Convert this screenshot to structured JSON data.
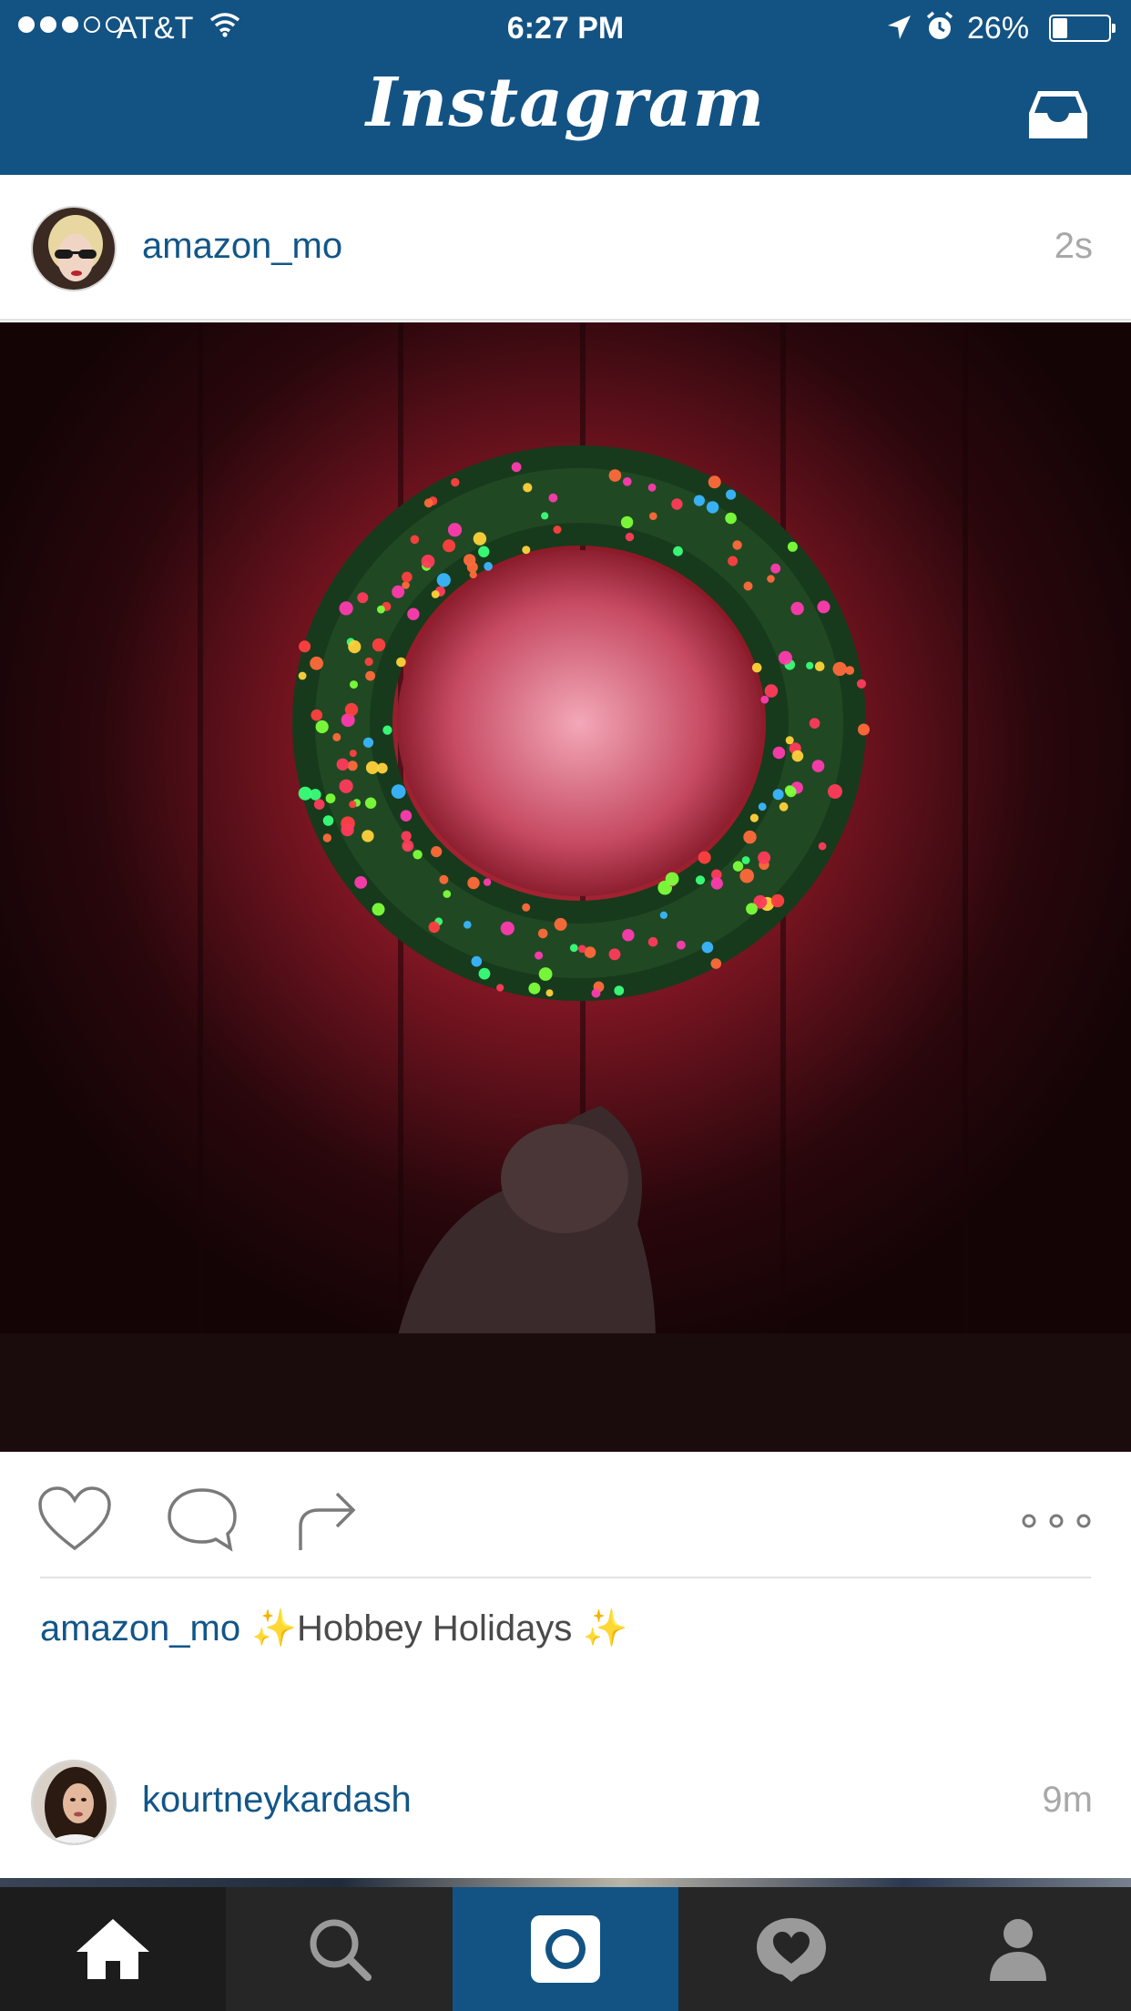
{
  "status_bar": {
    "carrier": "AT&T",
    "time": "6:27 PM",
    "battery_percent": "26%",
    "battery_level": 0.26,
    "signal_bars_filled": 3,
    "signal_bars_total": 5,
    "icons": [
      "signal-dots-icon",
      "wifi-icon",
      "location-arrow-icon",
      "alarm-icon",
      "battery-icon"
    ]
  },
  "nav": {
    "title": "Instagram",
    "right_icon": "inbox-icon",
    "background_color": "#135384"
  },
  "post": {
    "username": "amazon_mo",
    "time_ago": "2s",
    "photo_description_icon": "photo",
    "actions": [
      "heart-icon",
      "comment-icon",
      "share-icon",
      "more-options-icon"
    ],
    "caption": {
      "username": "amazon_mo",
      "sparkle_before": "✨",
      "text": "Hobbey Holidays",
      "sparkle_after": "✨"
    }
  },
  "next_post": {
    "username": "kourtneykardash",
    "time_ago": "9m"
  },
  "tab_bar": {
    "tabs": [
      {
        "icon": "home-icon",
        "active": true
      },
      {
        "icon": "search-icon",
        "active": false
      },
      {
        "icon": "camera-icon",
        "active": false
      },
      {
        "icon": "activity-heart-icon",
        "active": false
      },
      {
        "icon": "profile-icon",
        "active": false
      }
    ]
  },
  "colors": {
    "brand_blue": "#135384",
    "username_blue": "#125688",
    "muted_gray": "#a8a8a8",
    "tab_bar_bg": "#262626"
  }
}
